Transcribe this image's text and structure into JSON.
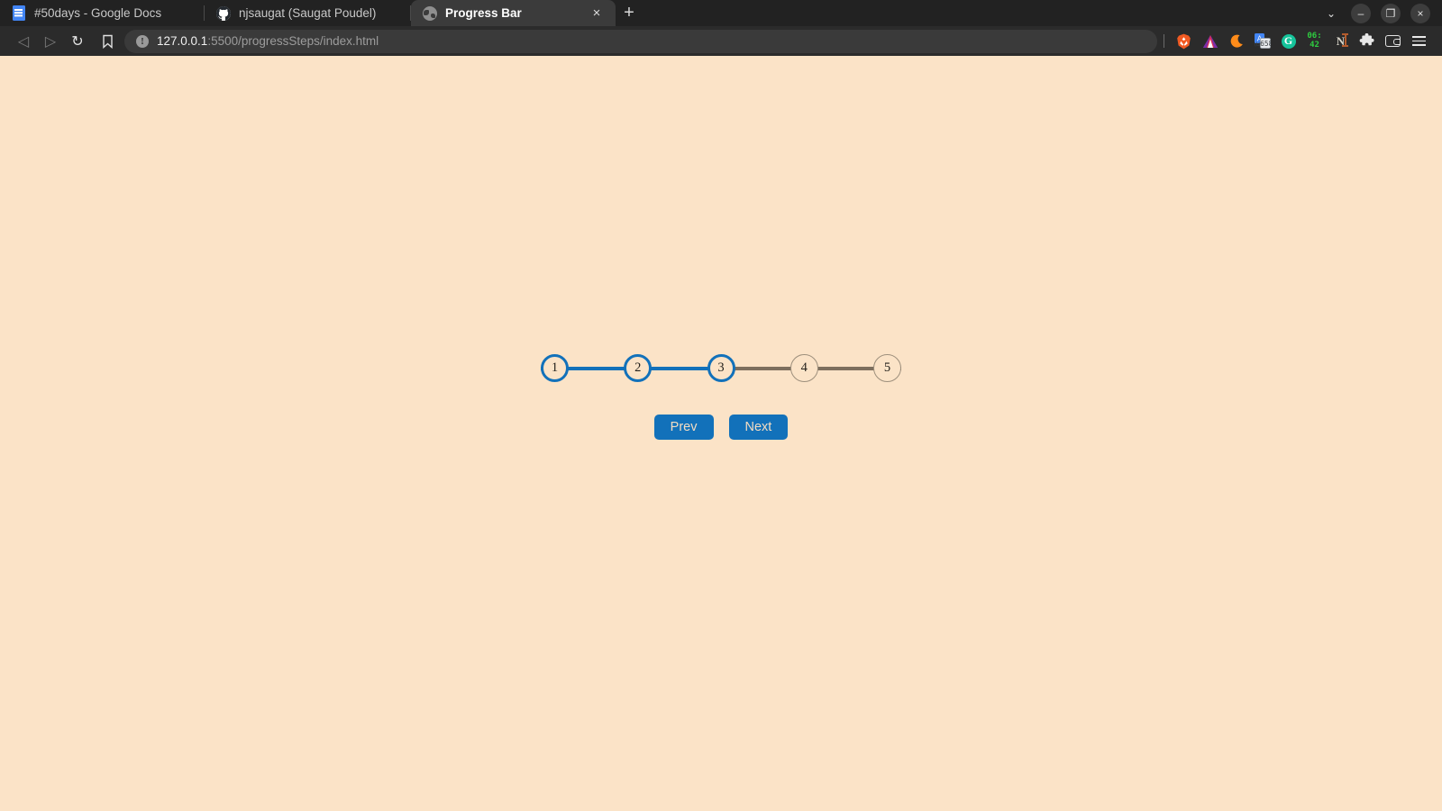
{
  "window": {
    "controls": {
      "tab_search_label": "⌄",
      "minimize_label": "–",
      "maximize_label": "❐",
      "close_label": "×"
    }
  },
  "tabs": [
    {
      "title": "#50days - Google Docs",
      "favicon": "google-docs-icon",
      "active": false
    },
    {
      "title": "njsaugat (Saugat Poudel)",
      "favicon": "github-icon",
      "active": false
    },
    {
      "title": "Progress Bar",
      "favicon": "globe-icon",
      "active": true,
      "close_label": "×"
    }
  ],
  "new_tab_label": "+",
  "toolbar": {
    "back_label": "◁",
    "forward_label": "▷",
    "reload_label": "↻",
    "bookmark_label": "bookmark-icon",
    "security_label": "!",
    "url_host": "127.0.0.1",
    "url_path": ":5500/progressSteps/index.html",
    "extensions": [
      {
        "name": "brave-shield-icon"
      },
      {
        "name": "brave-rewards-triangle-icon"
      },
      {
        "name": "dark-reader-moon-icon"
      },
      {
        "name": "google-translate-icon"
      },
      {
        "name": "grammarly-icon",
        "label": "G"
      },
      {
        "name": "clock-extension-icon",
        "line1": "06:",
        "line2": "42"
      },
      {
        "name": "neovim-icon",
        "label": "N"
      },
      {
        "name": "extensions-puzzle-icon",
        "label": "🧩"
      },
      {
        "name": "wallet-icon"
      },
      {
        "name": "browser-menu-icon"
      }
    ]
  },
  "page": {
    "background_color": "#fbe3c7",
    "accent_color": "#1271ba",
    "track_color": "#7d6f5e",
    "steps": [
      {
        "label": "1",
        "active": true
      },
      {
        "label": "2",
        "active": true
      },
      {
        "label": "3",
        "active": true
      },
      {
        "label": "4",
        "active": false
      },
      {
        "label": "5",
        "active": false
      }
    ],
    "current_step": 3,
    "total_steps": 5,
    "progress_percent": 50,
    "buttons": {
      "prev_label": "Prev",
      "next_label": "Next"
    }
  }
}
